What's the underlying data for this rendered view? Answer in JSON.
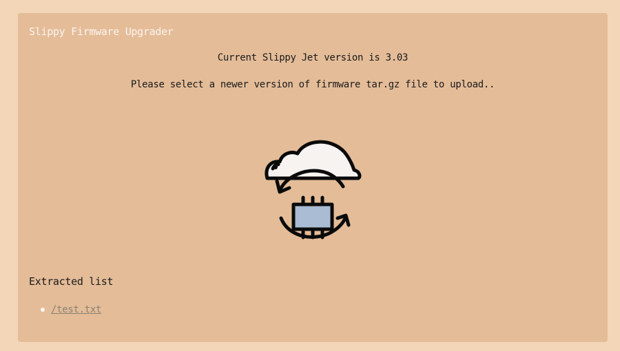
{
  "header": {
    "title": "Slippy Firmware Upgrader"
  },
  "main": {
    "version_text": "Current Slippy Jet version is 3.03",
    "prompt_text": "Please select a newer version of firmware tar.gz file to upload..",
    "upload_icon": "cloud-chip-sync-icon"
  },
  "extracted": {
    "heading": "Extracted list",
    "items": [
      {
        "label": "/test.txt"
      }
    ]
  },
  "colors": {
    "page_background": "#f3d6b8",
    "panel_background": "#e4bc98",
    "title_text": "#fbf5ef",
    "link": "#8a8273",
    "cloud_fill": "#f7f3f0",
    "chip_fill": "#a9bcd3"
  }
}
